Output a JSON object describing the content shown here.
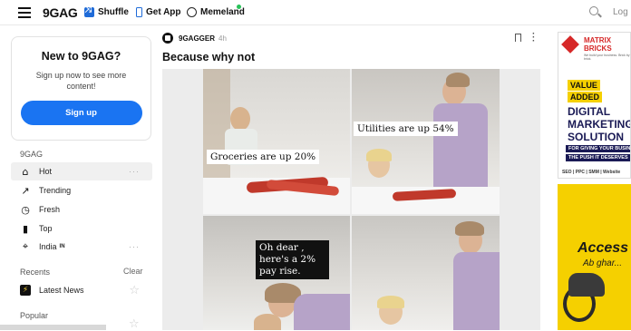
{
  "header": {
    "logo": "9GAG",
    "nav": [
      {
        "label": "Shuffle",
        "icon": "shuffle-icon"
      },
      {
        "label": "Get App",
        "icon": "phone-icon"
      },
      {
        "label": "Memeland",
        "icon": "memeland-icon"
      }
    ],
    "login_label": "Log in"
  },
  "signup_card": {
    "title": "New to 9GAG?",
    "text": "Sign up now to see more content!",
    "button": "Sign up"
  },
  "sidebar": {
    "section_9gag": "9GAG",
    "items": [
      {
        "label": "Hot",
        "icon": "flame-icon",
        "active": true
      },
      {
        "label": "Trending",
        "icon": "trending-icon"
      },
      {
        "label": "Fresh",
        "icon": "clock-icon"
      },
      {
        "label": "Top",
        "icon": "bar-chart-icon"
      },
      {
        "label": "India",
        "tag": "IN",
        "icon": "location-icon"
      }
    ],
    "recents_label": "Recents",
    "clear_label": "Clear",
    "recents": [
      {
        "label": "Latest News",
        "icon": "lightning-icon"
      }
    ],
    "popular_label": "Popular"
  },
  "post": {
    "author": "9GAGGER",
    "age": "4h",
    "title": "Because why not",
    "captions": {
      "groceries": "Groceries are up 20%",
      "utilities": "Utilities are up 54%",
      "payrise": "Oh dear , here's a 2% pay rise."
    }
  },
  "ads": {
    "brand": "MATRIX BRICKS",
    "tagline": "We build your business. Brick by brick.",
    "lines": [
      "VALUE",
      "ADDED",
      "DIGITAL",
      "MARKETING",
      "SOLUTION"
    ],
    "sub1": "FOR GIVING YOUR BUSINESS",
    "sub2": "THE PUSH IT DESERVES",
    "services": "SEO | PPC | SMM | Website",
    "ad2_title": "Access",
    "ad2_sub": "Ab ghar..."
  }
}
